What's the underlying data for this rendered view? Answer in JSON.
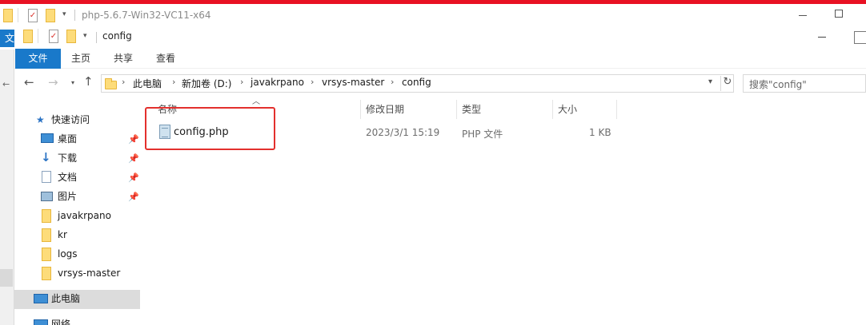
{
  "back_window": {
    "title": "php-5.6.7-Win32-VC11-x64",
    "file_tab_fragment": "文"
  },
  "window": {
    "title": "config"
  },
  "ribbon": {
    "tabs": [
      "文件",
      "主页",
      "共享",
      "查看"
    ]
  },
  "address_bar": {
    "crumbs": [
      "此电脑",
      "新加卷 (D:)",
      "javakrpano",
      "vrsys-master",
      "config"
    ]
  },
  "search": {
    "placeholder": "搜索\"config\""
  },
  "nav_pane": {
    "quick_access": "快速访问",
    "pinned": [
      "桌面",
      "下载",
      "文档",
      "图片"
    ],
    "folders": [
      "javakrpano",
      "kr",
      "logs",
      "vrsys-master"
    ],
    "this_pc": "此电脑",
    "network": "网络"
  },
  "columns": {
    "name": "名称",
    "modified": "修改日期",
    "type": "类型",
    "size": "大小"
  },
  "files": [
    {
      "name": "config.php",
      "modified": "2023/3/1 15:19",
      "type": "PHP 文件",
      "size": "1 KB"
    }
  ],
  "colors": {
    "accent": "#1979ca",
    "top_strip": "#e81123",
    "annotation": "#e3302d",
    "folder": "#fddc7a"
  }
}
